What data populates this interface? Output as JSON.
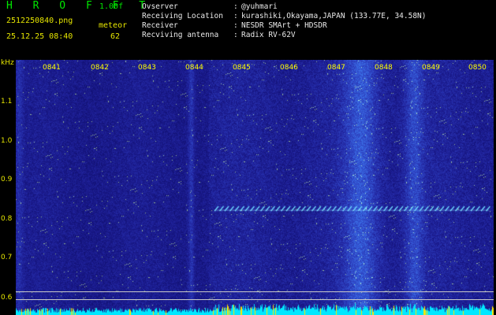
{
  "header": {
    "brand": "H R O F F T",
    "version": "1.00f",
    "filename": "2512250840.png",
    "mode": "meteor",
    "timestamp": "25.12.25 08:40",
    "count": "62",
    "info": [
      {
        "key": "Ovserver",
        "value": "@yuhmari"
      },
      {
        "key": "Receiving Location",
        "value": "kurashiki,Okayama,JAPAN (133.77E, 34.58N)"
      },
      {
        "key": "Receiver",
        "value": "NESDR SMArt + HDSDR"
      },
      {
        "key": "Recviving antenna",
        "value": "Radix RV-62V"
      }
    ],
    "separator": ":"
  },
  "spectrogram": {
    "y_unit": "kHz",
    "y_ticks": [
      "1.1",
      "1.0",
      "0.9",
      "0.8",
      "0.7",
      "0.6"
    ],
    "x_ticks": [
      "0841",
      "0842",
      "0843",
      "0844",
      "0845",
      "0846",
      "0847",
      "0848",
      "0849",
      "0850"
    ],
    "colors": {
      "background": "#0a14b4",
      "signal": "#5ad2ff",
      "label_yellow": "#ffff00",
      "baseline": "#00e8ff"
    }
  }
}
